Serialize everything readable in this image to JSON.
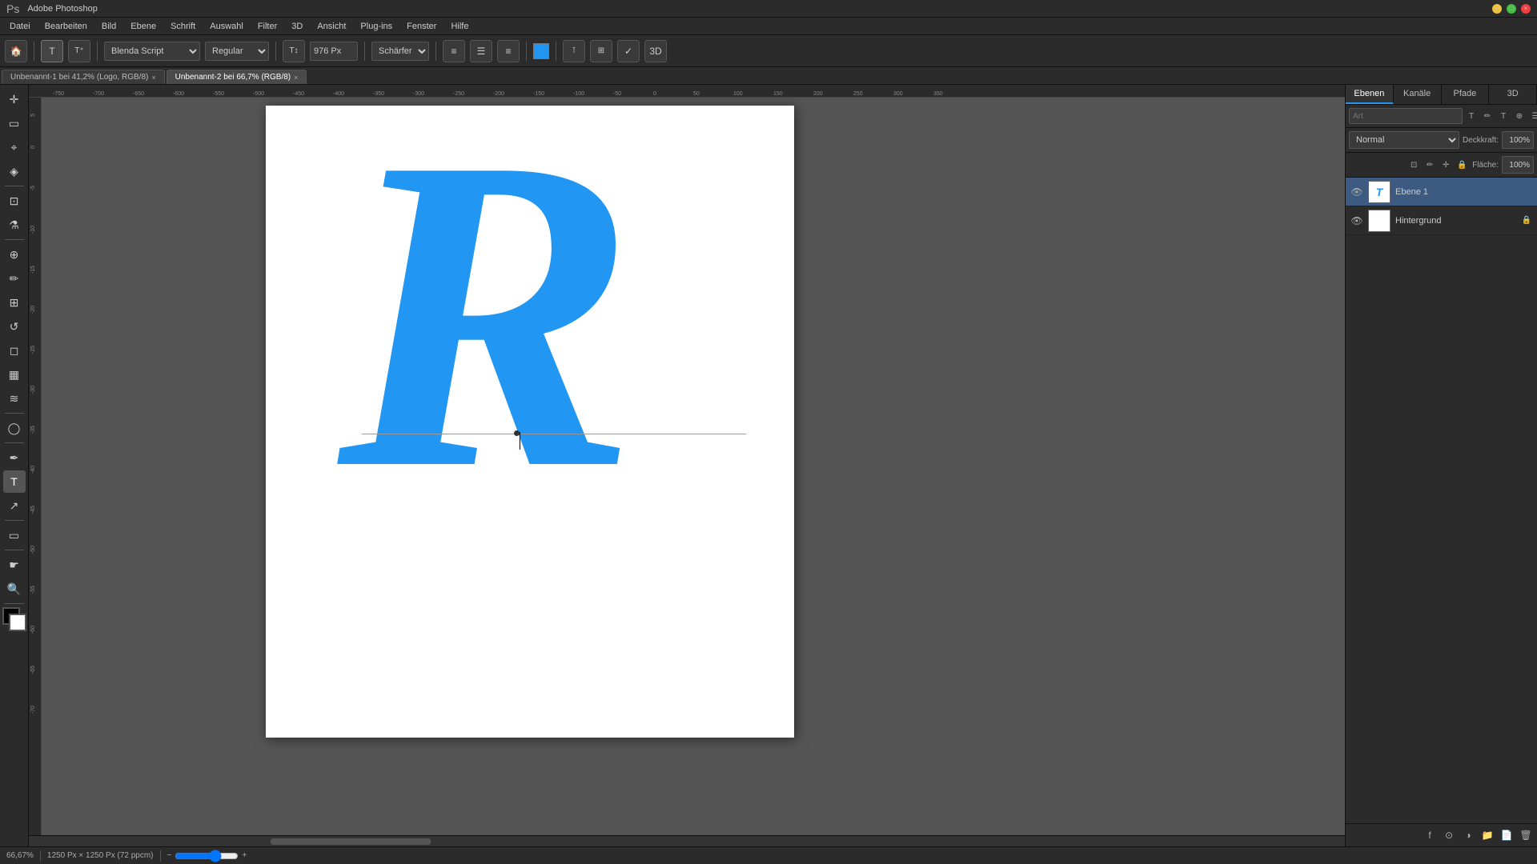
{
  "titlebar": {
    "title": "Adobe Photoshop",
    "min_label": "−",
    "max_label": "□",
    "close_label": "×"
  },
  "menubar": {
    "items": [
      "Datei",
      "Bearbeiten",
      "Bild",
      "Ebene",
      "Schrift",
      "Auswahl",
      "Filter",
      "3D",
      "Ansicht",
      "Plug-ins",
      "Fenster",
      "Hilfe"
    ]
  },
  "toolbar": {
    "font_family": "Blenda Script",
    "font_style": "Regular",
    "font_size": "976 Px",
    "anti_alias": "Schärfer",
    "align_left_label": "≡",
    "align_center_label": "≡",
    "align_right_label": "≡"
  },
  "tabs": [
    {
      "label": "Unbenannt-1 bei 41,2% (Logo, RGB/8)",
      "active": false,
      "closable": true
    },
    {
      "label": "Unbenannt-2 bei 66,7% (RGB/8)",
      "active": true,
      "closable": true
    }
  ],
  "tools": [
    {
      "name": "move-tool",
      "icon": "✛"
    },
    {
      "name": "selection-tool",
      "icon": "▭"
    },
    {
      "name": "lasso-tool",
      "icon": "⌖"
    },
    {
      "name": "magic-wand-tool",
      "icon": "⊹"
    },
    {
      "name": "crop-tool",
      "icon": "⊡"
    },
    {
      "name": "eyedropper-tool",
      "icon": "⚗"
    },
    {
      "name": "healing-tool",
      "icon": "⊕"
    },
    {
      "name": "brush-tool",
      "icon": "✏"
    },
    {
      "name": "clone-tool",
      "icon": "⊞"
    },
    {
      "name": "eraser-tool",
      "icon": "◻"
    },
    {
      "name": "gradient-tool",
      "icon": "▦"
    },
    {
      "name": "dodge-tool",
      "icon": "◯"
    },
    {
      "name": "pen-tool",
      "icon": "✒"
    },
    {
      "name": "text-tool",
      "icon": "T",
      "active": true
    },
    {
      "name": "path-select-tool",
      "icon": "↗"
    },
    {
      "name": "shape-tool",
      "icon": "◯"
    },
    {
      "name": "hand-tool",
      "icon": "☛"
    },
    {
      "name": "zoom-tool",
      "icon": "⊕"
    }
  ],
  "canvas": {
    "letter": "R",
    "letter_color": "#2196f3",
    "bg_color": "#ffffff"
  },
  "layers_panel": {
    "tabs": [
      "Ebenen",
      "Kanäle",
      "Pfade",
      "3D"
    ],
    "search_placeholder": "Art",
    "blend_mode": "Normal",
    "opacity_label": "Deckkraft:",
    "opacity_value": "100%",
    "fill_label": "Fläche:",
    "fill_value": "100%",
    "layers": [
      {
        "name": "Ebene 1",
        "type": "text",
        "visible": true,
        "locked": false,
        "active": true
      },
      {
        "name": "Hintergrund",
        "type": "background",
        "visible": true,
        "locked": true,
        "active": false
      }
    ]
  },
  "statusbar": {
    "zoom": "66,67%",
    "dimensions": "1250 Px × 1250 Px (72 ppcm)"
  }
}
